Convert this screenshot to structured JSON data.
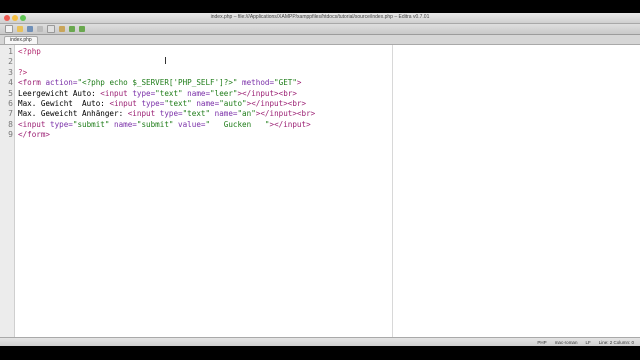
{
  "window": {
    "title": "index.php – file:///Applications/XAMPP/xamppfiles/htdocs/tutorial/source/index.php – Editra v0.7.01"
  },
  "toolbar": {
    "icons": [
      "new-file-icon",
      "open-folder-icon",
      "save-icon",
      "cut-icon",
      "copy-icon",
      "paste-icon",
      "undo-icon",
      "redo-icon"
    ]
  },
  "tabs": [
    {
      "label": "index.php"
    }
  ],
  "editor": {
    "line_numbers": [
      "1",
      "2",
      "3",
      "4",
      "5",
      "6",
      "7",
      "8",
      "9"
    ],
    "lines": [
      [
        {
          "t": "<?php",
          "c": "php"
        }
      ],
      [],
      [
        {
          "t": "?>",
          "c": "php"
        }
      ],
      [
        {
          "t": "<form ",
          "c": "tag"
        },
        {
          "t": "action=",
          "c": "attr"
        },
        {
          "t": "\"<?php echo $_SERVER['PHP_SELF']?>\"",
          "c": "str"
        },
        {
          "t": " method=",
          "c": "attr"
        },
        {
          "t": "\"GET\"",
          "c": "str"
        },
        {
          "t": ">",
          "c": "tag"
        }
      ],
      [
        {
          "t": "Leergewicht Auto: ",
          "c": "txt"
        },
        {
          "t": "<input ",
          "c": "tag"
        },
        {
          "t": "type=",
          "c": "attr"
        },
        {
          "t": "\"text\"",
          "c": "str"
        },
        {
          "t": " name=",
          "c": "attr"
        },
        {
          "t": "\"leer\"",
          "c": "str"
        },
        {
          "t": "></input><br>",
          "c": "tag"
        }
      ],
      [
        {
          "t": "Max. Gewicht  Auto: ",
          "c": "txt"
        },
        {
          "t": "<input ",
          "c": "tag"
        },
        {
          "t": "type=",
          "c": "attr"
        },
        {
          "t": "\"text\"",
          "c": "str"
        },
        {
          "t": " name=",
          "c": "attr"
        },
        {
          "t": "\"auto\"",
          "c": "str"
        },
        {
          "t": "></input><br>",
          "c": "tag"
        }
      ],
      [
        {
          "t": "Max. Geweicht Anhänger: ",
          "c": "txt"
        },
        {
          "t": "<input ",
          "c": "tag"
        },
        {
          "t": "type=",
          "c": "attr"
        },
        {
          "t": "\"text\"",
          "c": "str"
        },
        {
          "t": " name=",
          "c": "attr"
        },
        {
          "t": "\"an\"",
          "c": "str"
        },
        {
          "t": "></input><br>",
          "c": "tag"
        }
      ],
      [
        {
          "t": "<input ",
          "c": "tag"
        },
        {
          "t": "type=",
          "c": "attr"
        },
        {
          "t": "\"submit\"",
          "c": "str"
        },
        {
          "t": " name=",
          "c": "attr"
        },
        {
          "t": "\"submit\"",
          "c": "str"
        },
        {
          "t": " value=",
          "c": "attr"
        },
        {
          "t": "\"   Gucken   \"",
          "c": "str"
        },
        {
          "t": "></input>",
          "c": "tag"
        }
      ],
      [
        {
          "t": "</form>",
          "c": "tag"
        }
      ]
    ]
  },
  "statusbar": {
    "language": "PHP",
    "encoding": "mac-roman",
    "eol": "LF",
    "position": "Line: 2  Column: 0"
  },
  "colors": {
    "tag": "#9b1f73",
    "attribute": "#7a2fa8",
    "string": "#1e7c18",
    "php": "#b0276d"
  }
}
